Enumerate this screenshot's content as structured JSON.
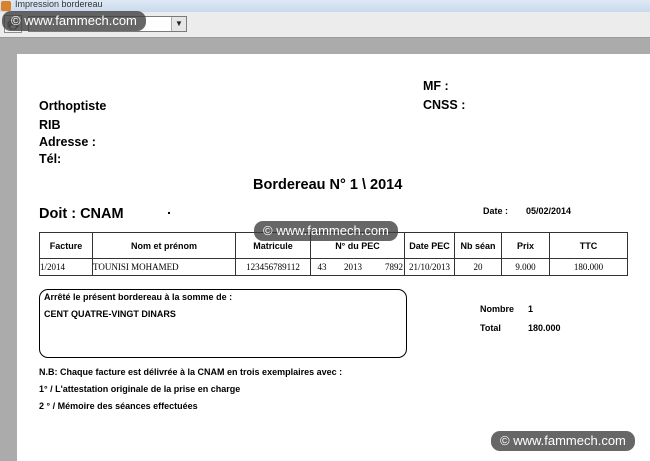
{
  "window": {
    "title": "Impression bordereau"
  },
  "toolbar": {
    "print_icon": "printer-icon",
    "zoom_value": ""
  },
  "watermarks": [
    "© www.fammech.com",
    "© www.fammech.com",
    "© www.fammech.com"
  ],
  "header": {
    "left": {
      "profession": "Orthoptiste",
      "rib_label": "RIB",
      "adresse_label": "Adresse :",
      "tel_label": "Tél:"
    },
    "right": {
      "mf_label": "MF :",
      "cnss_label": "CNSS :"
    }
  },
  "document": {
    "title": "Bordereau N° 1 \\ 2014",
    "doit": "Doit : CNAM",
    "date_label": "Date :",
    "date_value": "05/02/2014"
  },
  "table": {
    "headers": [
      "Facture",
      "Nom et prénom",
      "Matricule",
      "N° du PEC",
      "Date PEC",
      "Nb séan",
      "Prix",
      "TTC"
    ],
    "rows": [
      {
        "facture": "1/2014",
        "nom": "TOUNISI MOHAMED",
        "matricule": "123456789112",
        "pec_1": "43",
        "pec_2": "2013",
        "pec_3": "7892",
        "date_pec": "21/10/2013",
        "nb_seances": "20",
        "prix": "9.000",
        "ttc": "180.000"
      }
    ]
  },
  "summary": {
    "arrete_label": "Arrêté le présent bordereau à la somme de :",
    "amount_words": "CENT QUATRE-VINGT DINARS",
    "nombre_label": "Nombre",
    "nombre_value": "1",
    "total_label": "Total",
    "total_value": "180.000"
  },
  "notes": {
    "nb": "N.B: Chaque facture est délivrée à la CNAM en trois exemplaires avec :",
    "item1": "1° / L'attestation originale de la prise en charge",
    "item2": "2 ° / Mémoire des séances effectuées"
  }
}
